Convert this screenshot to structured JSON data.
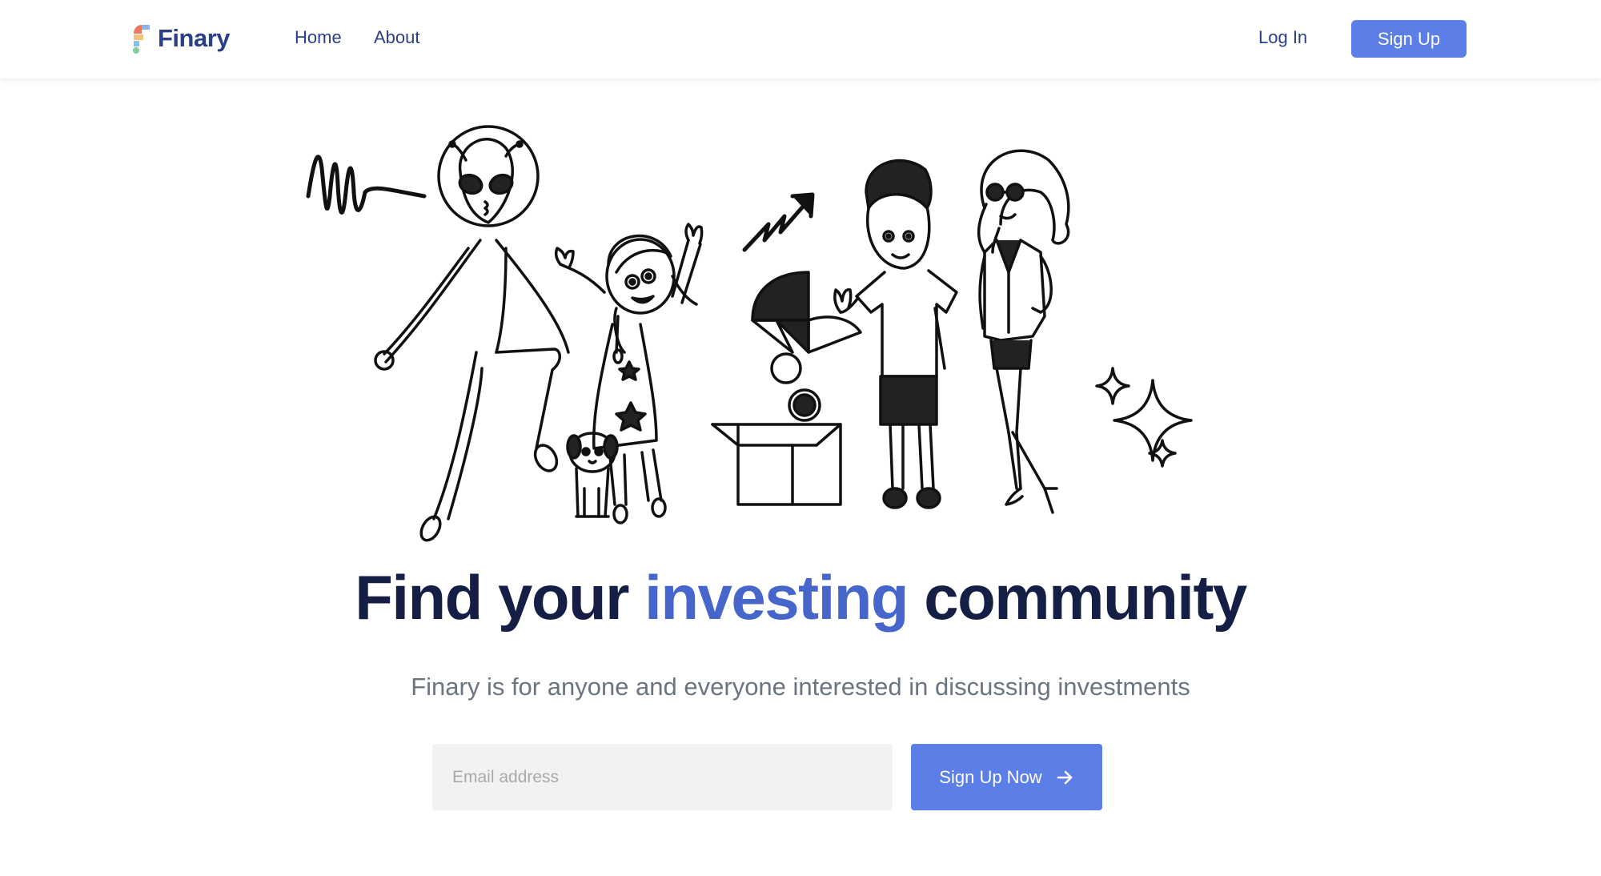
{
  "brand": {
    "name": "Finary",
    "logo_icon": "finary-logo-icon",
    "logo_colors": [
      "#e87a65",
      "#f4c27a",
      "#7fc4e8",
      "#7ecf9b"
    ]
  },
  "nav": {
    "links": [
      {
        "label": "Home"
      },
      {
        "label": "About"
      }
    ],
    "login_label": "Log In",
    "signup_label": "Sign Up"
  },
  "hero": {
    "illustration": "community-doodle-illustration",
    "title_part1": "Find your ",
    "title_accent": "investing",
    "title_part2": " community",
    "subtitle": "Finary is for anyone and everyone interested in discussing investments"
  },
  "form": {
    "email_placeholder": "Email address",
    "email_value": "",
    "submit_label": "Sign Up Now",
    "submit_icon": "arrow-right-icon"
  },
  "colors": {
    "primary": "#5b7fe6",
    "heading": "#151e45",
    "accent": "#4766cc",
    "nav_text": "#2b3f86",
    "subtitle": "#6b7481",
    "input_bg": "#f2f2f2"
  }
}
